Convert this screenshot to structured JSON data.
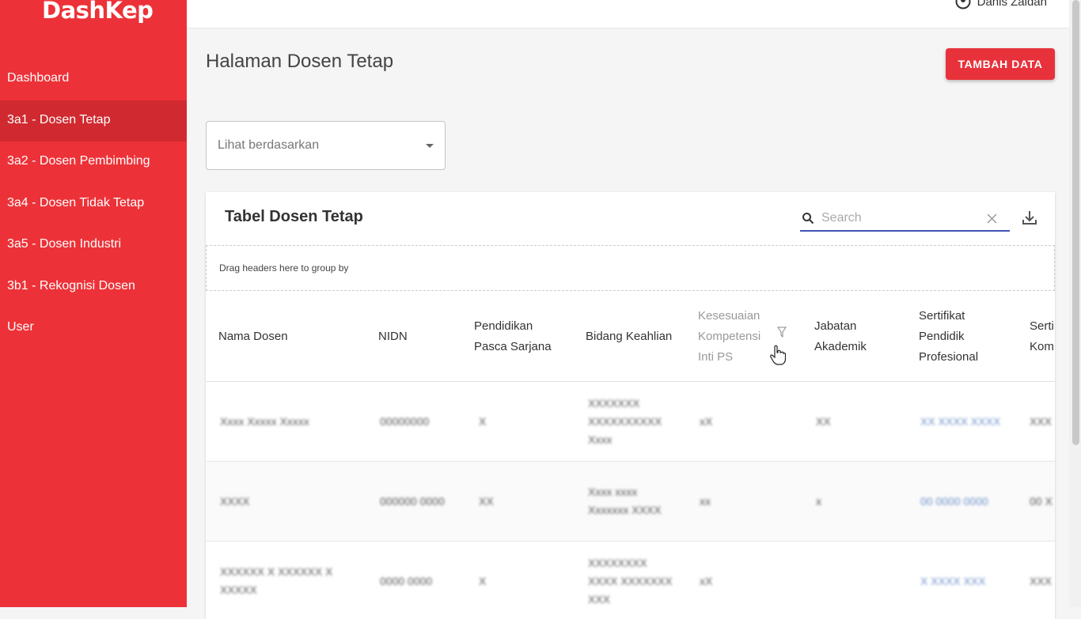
{
  "app": {
    "brand": "DashKep"
  },
  "sidebar": {
    "items": [
      {
        "label": "Dashboard"
      },
      {
        "label": "3a1 - Dosen Tetap"
      },
      {
        "label": "3a2 - Dosen Pembimbing"
      },
      {
        "label": "3a4 - Dosen Tidak Tetap"
      },
      {
        "label": "3a5 - Dosen Industri"
      },
      {
        "label": "3b1 - Rekognisi Dosen"
      },
      {
        "label": "User"
      }
    ]
  },
  "header": {
    "user_name": "Danis Zaidan"
  },
  "page": {
    "title": "Halaman Dosen Tetap",
    "add_button": "TAMBAH DATA"
  },
  "filter": {
    "label": "Lihat berdasarkan"
  },
  "table": {
    "title": "Tabel Dosen Tetap",
    "search_placeholder": "Search",
    "group_hint": "Drag headers here to group by",
    "columns": [
      {
        "label": "Nama Dosen"
      },
      {
        "label": "NIDN"
      },
      {
        "label": "Pendidikan Pasca Sarjana"
      },
      {
        "label": "Bidang Keahlian"
      },
      {
        "label": "Kesesuaian Kompetensi Inti PS"
      },
      {
        "label": "Jabatan Akademik"
      },
      {
        "label": "Sertifikat Pendidik Profesional"
      },
      {
        "label": "Serti Kom"
      }
    ],
    "rows": [
      [
        "Xxxx Xxxxx Xxxxx",
        "00000000",
        "X",
        "XXXXXXX XXXXXXXXXX Xxxx",
        "xX",
        "XX",
        "XX XXXX XXXX",
        "XXX"
      ],
      [
        "XXXX",
        "000000 0000",
        "XX",
        "Xxxx xxxx Xxxxxxx XXXX",
        "xx",
        "x",
        "00 0000 0000",
        "00 X"
      ],
      [
        "XXXXXX X XXXXXX X XXXXX",
        "0000 0000",
        "X",
        "XXXXXXXX XXXX XXXXXXX XXX",
        "xX",
        "",
        "X XXXX XXX",
        "XXX"
      ]
    ]
  }
}
